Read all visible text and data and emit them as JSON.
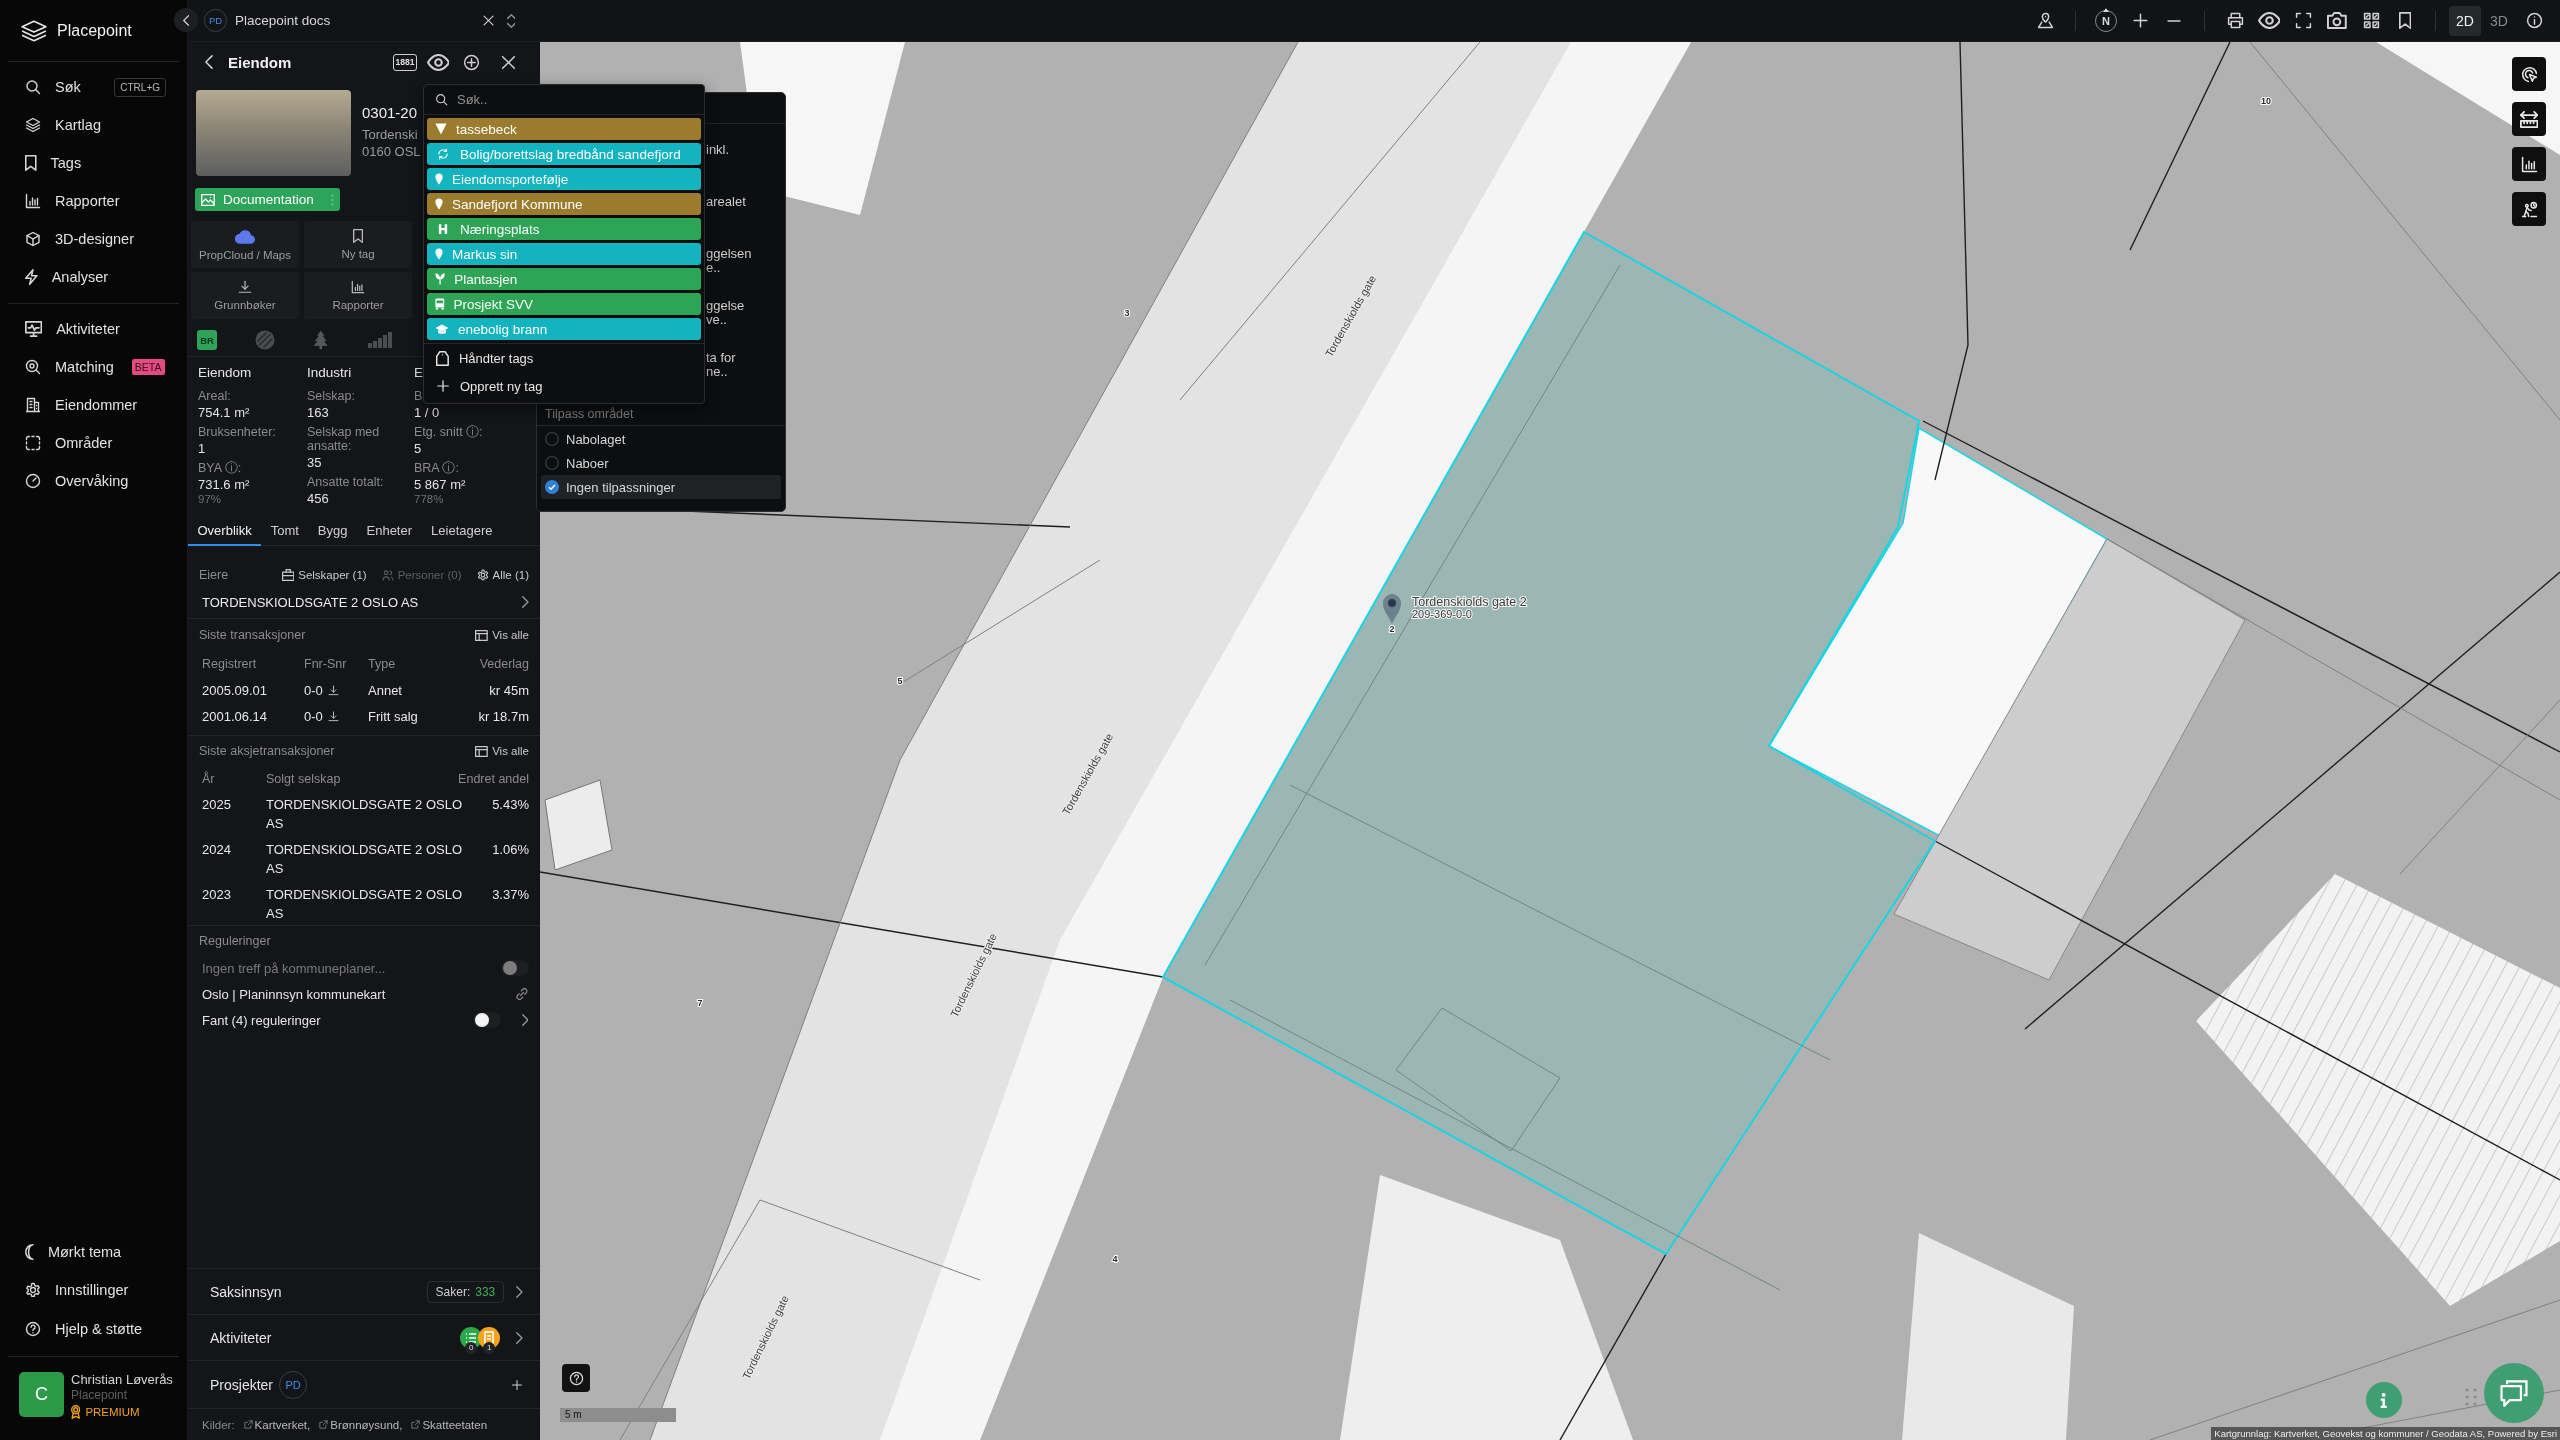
{
  "sidebar": {
    "brand": "Placepoint",
    "main_items": [
      {
        "label": "Søk",
        "shortcut": "CTRL+G"
      },
      {
        "label": "Kartlag"
      },
      {
        "label": "Tags"
      },
      {
        "label": "Rapporter"
      },
      {
        "label": "3D-designer"
      },
      {
        "label": "Analyser"
      }
    ],
    "data_items": [
      {
        "label": "Aktiviteter"
      },
      {
        "label": "Matching",
        "badge": "BETA"
      },
      {
        "label": "Eiendommer"
      },
      {
        "label": "Områder"
      },
      {
        "label": "Overvåking"
      }
    ],
    "bottom_items": [
      {
        "label": "Mørkt tema"
      },
      {
        "label": "Innstillinger"
      },
      {
        "label": "Hjelp & støtte"
      }
    ],
    "user": {
      "initial": "C",
      "name": "Christian Løverås",
      "organization": "Placepoint",
      "plan": "PREMIUM"
    }
  },
  "top_bar": {
    "project_badge": "PD",
    "project_title": "Placepoint docs"
  },
  "panel": {
    "title": "Eiendom",
    "badge": "1881",
    "property": {
      "id": "0301-20",
      "address": "Tordenski",
      "postal": "0160 OSL"
    },
    "documentation_button": "Documentation",
    "actions": [
      "PropCloud / Maps",
      "Ny tag",
      "Grunnbøker",
      "Rapporter"
    ],
    "source_badge": "BR",
    "stats": [
      {
        "title": "Eiendom",
        "fields": [
          {
            "label": "Areal:",
            "value": "754.1 m²"
          },
          {
            "label": "Bruksenheter:",
            "value": "1"
          },
          {
            "label": "BYA ⓘ:",
            "value": "731.6 m²",
            "share": "97%"
          }
        ]
      },
      {
        "title": "Industri",
        "fields": [
          {
            "label": "Selskap:",
            "value": "163"
          },
          {
            "label": "Selskap med ansatte:",
            "value": "35"
          },
          {
            "label": "Ansatte totalt:",
            "value": "456"
          }
        ]
      },
      {
        "title": "E",
        "fields": [
          {
            "label": "B",
            "value": "1 / 0"
          },
          {
            "label": "Etg. snitt ⓘ:",
            "value": "5"
          },
          {
            "label": "BRA ⓘ:",
            "value": "5 867 m²",
            "share": "778%"
          }
        ]
      }
    ],
    "tabs": [
      {
        "label": "Overblikk",
        "selected": true
      },
      {
        "label": "Tomt",
        "selected": false
      },
      {
        "label": "Bygg",
        "selected": false
      },
      {
        "label": "Enheter",
        "selected": false
      },
      {
        "label": "Leietagere",
        "selected": false
      }
    ],
    "owners": {
      "title": "Eiere",
      "filters": [
        {
          "label": "Selskaper (1)",
          "disabled": false
        },
        {
          "label": "Personer (0)",
          "disabled": true
        },
        {
          "label": "Alle (1)",
          "disabled": false
        }
      ],
      "rows": [
        "TORDENSKIOLDSGATE 2 OSLO AS"
      ]
    },
    "transactions": {
      "title": "Siste transaksjoner",
      "link": "Vis alle",
      "columns": [
        "Registrert",
        "Fnr-Snr",
        "Type",
        "Vederlag"
      ],
      "rows": [
        {
          "date": "2005.09.01",
          "fnr_snr": "0-0",
          "type": "Annet",
          "amount": "kr 45m"
        },
        {
          "date": "2001.06.14",
          "fnr_snr": "0-0",
          "type": "Fritt salg",
          "amount": "kr 18.7m"
        }
      ]
    },
    "share_transactions": {
      "title": "Siste aksjetransaksjoner",
      "link": "Vis alle",
      "columns": [
        "År",
        "Solgt selskap",
        "Endret andel"
      ],
      "rows": [
        {
          "year": "2025",
          "company": "TORDENSKIOLDSGATE 2 OSLO AS",
          "share": "5.43%"
        },
        {
          "year": "2024",
          "company": "TORDENSKIOLDSGATE 2 OSLO AS",
          "share": "1.06%"
        },
        {
          "year": "2023",
          "company": "TORDENSKIOLDSGATE 2 OSLO AS",
          "share": "3.37%"
        }
      ]
    },
    "regulations": {
      "title": "Reguleringer",
      "rows": [
        {
          "kind": "toggle",
          "label": "Ingen treff på kommuneplaner...",
          "on": false,
          "disabled": true
        },
        {
          "kind": "link",
          "label": "Oslo | Planinnsyn kommunekart",
          "disabled": false
        },
        {
          "kind": "expander",
          "label": "Fant (4) reguleringer",
          "on": false,
          "disabled": false
        }
      ]
    },
    "sections": [
      {
        "kind": "cases",
        "label": "Saksinnsyn",
        "count_label": "Saker:",
        "count": "333"
      },
      {
        "kind": "activities",
        "label": "Aktiviteter",
        "counts": [
          "0",
          "1"
        ]
      },
      {
        "kind": "projects",
        "label": "Prosjekter",
        "badge": "PD"
      }
    ],
    "sources": {
      "label": "Kilder:",
      "links": [
        "Kartverket,",
        "Brønnøysund,",
        "Skatteetaten"
      ]
    }
  },
  "tag_menu": {
    "placeholder": "Søk..",
    "tags": [
      {
        "label": "tassebeck",
        "color": "#9b7b2e"
      },
      {
        "label": "Bolig/borettslag bredbånd sandefjord",
        "color": "#13b3bf"
      },
      {
        "label": "Eiendomsportefølje",
        "color": "#13b3bf"
      },
      {
        "label": "Sandefjord Kommune",
        "color": "#9b7b2e"
      },
      {
        "label": "Næringsplats",
        "color": "#2ea556"
      },
      {
        "label": "Markus sin",
        "color": "#13b3bf"
      },
      {
        "label": "Plantasjen",
        "color": "#2ea556"
      },
      {
        "label": "Prosjekt SVV",
        "color": "#2ea556"
      },
      {
        "label": "enebolig brann",
        "color": "#13b3bf"
      }
    ],
    "actions": [
      "Håndter tags",
      "Opprett ny tag"
    ]
  },
  "area_popup": {
    "fragments": [
      [
        "inkl."
      ],
      [
        "arealet"
      ],
      [
        "ggelsen",
        "e.."
      ],
      [
        "ggelse",
        "ve.."
      ],
      [
        "ta for",
        "ne.."
      ]
    ],
    "section_title": "Tilpass området",
    "options": [
      {
        "label": "Nabolaget",
        "selected": false
      },
      {
        "label": "Naboer",
        "selected": false
      },
      {
        "label": "Ingen tilpassninger",
        "selected": true
      }
    ]
  },
  "map": {
    "toolbar": {
      "compass": "N",
      "modes": [
        {
          "label": "2D",
          "selected": true
        },
        {
          "label": "3D",
          "selected": false
        }
      ]
    },
    "street_labels": [
      "Tordenskiolds gate",
      "Tordenskiolds gate",
      "Tordenskiolds gate",
      "Tordenskiolds gate"
    ],
    "house_numbers": [
      "10",
      "3",
      "5",
      "7",
      "4",
      "2"
    ],
    "pin": {
      "title": "Tordenskiolds gate 2",
      "subtitle": "209-369-0-0"
    },
    "scale": "5 m",
    "attribution": "Kartgrunnlag: Kartverket, Geovekst og kommuner / Geodata AS, Powered by Esri"
  }
}
